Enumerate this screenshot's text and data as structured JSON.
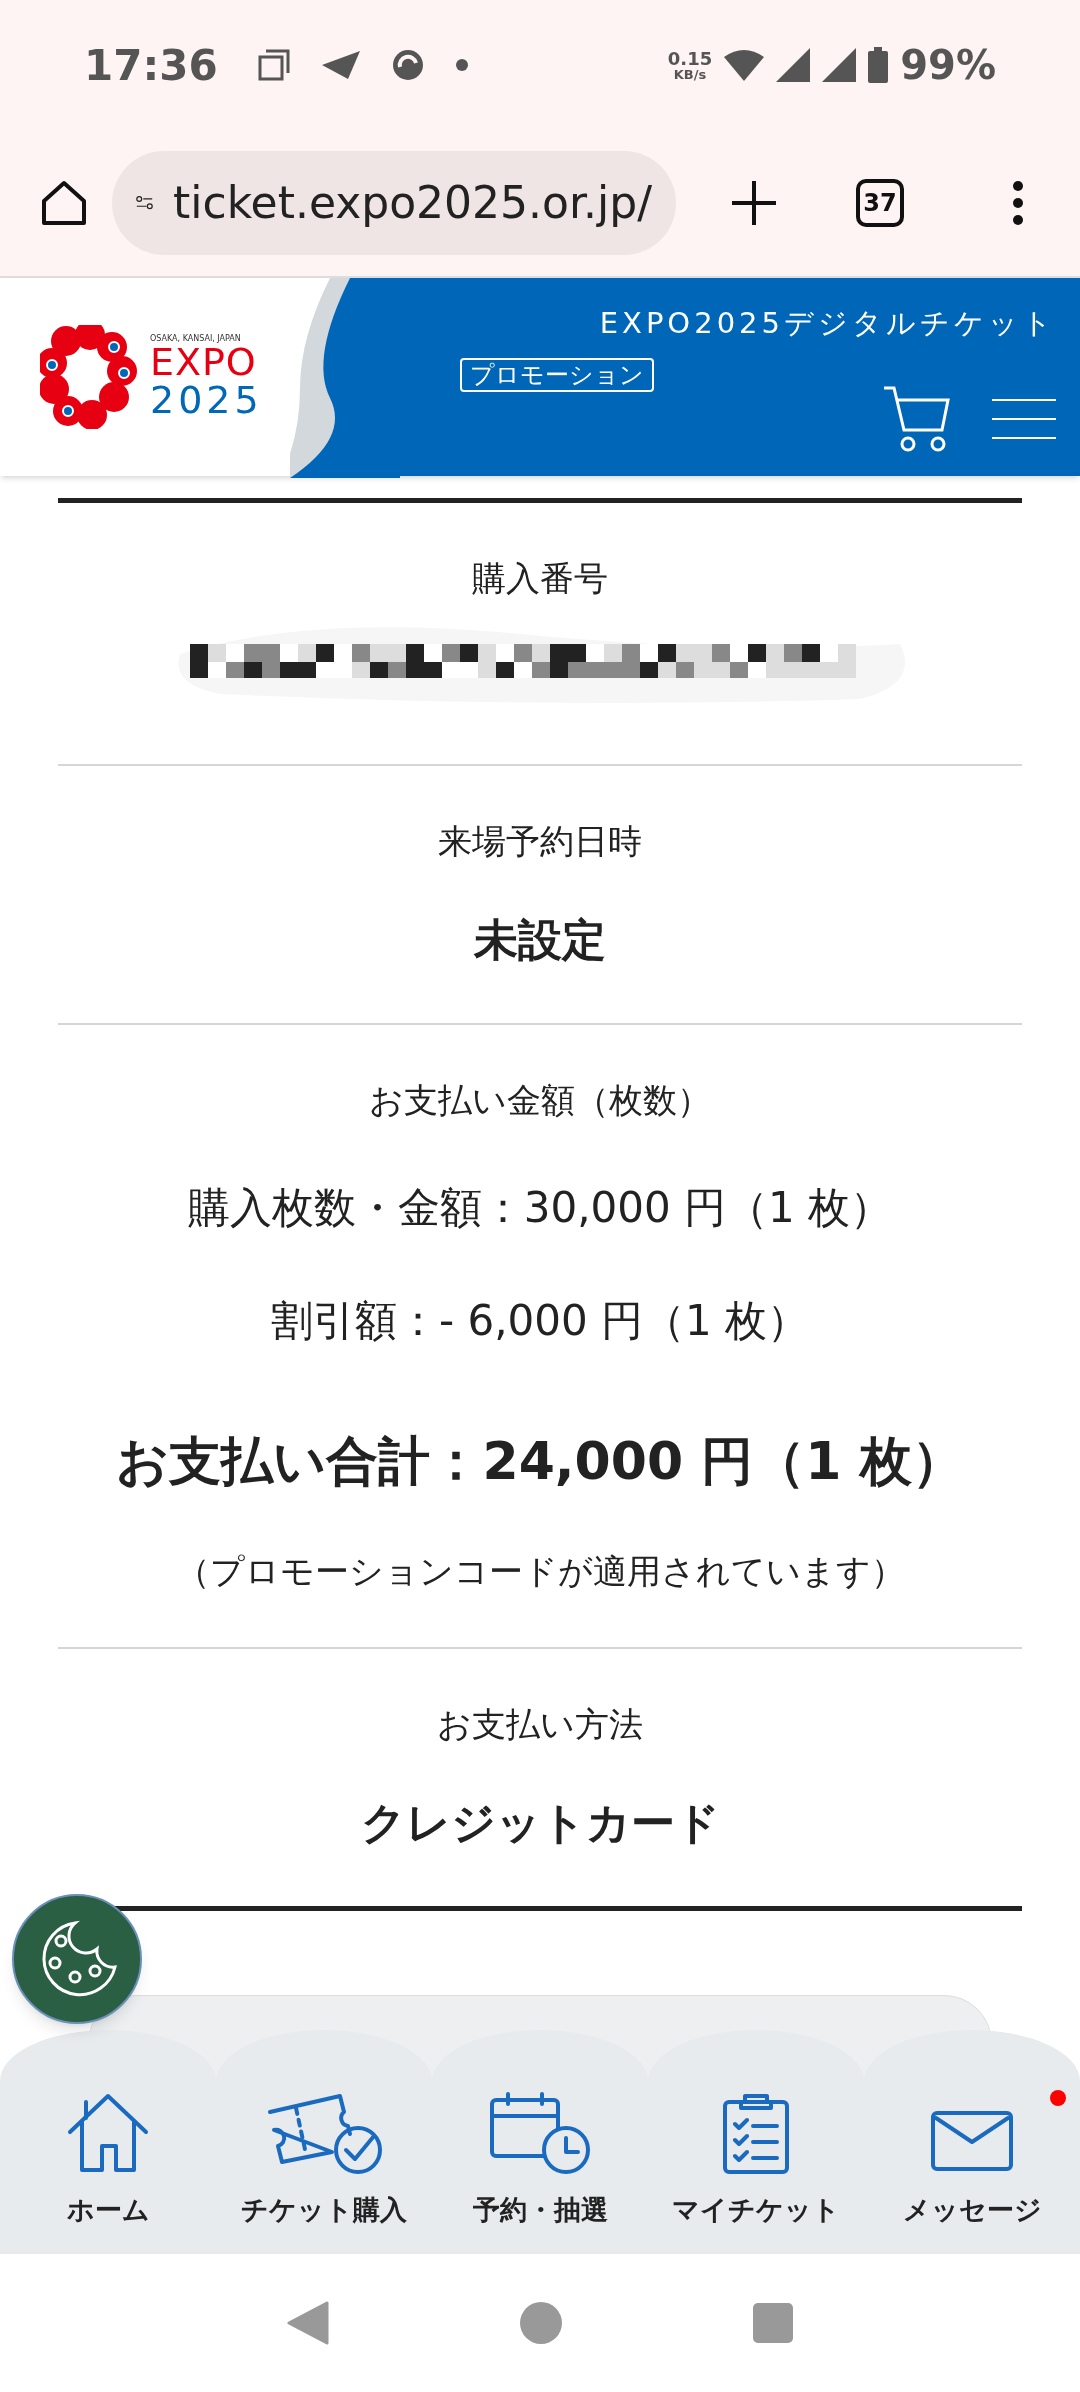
{
  "status_bar": {
    "time": "17:36",
    "net_speed": "0.15",
    "net_unit": "KB/s",
    "battery": "99%"
  },
  "browser": {
    "url": "ticket.expo2025.or.jp/",
    "tab_count": "37"
  },
  "header": {
    "logo_tagline": "OSAKA, KANSAI, JAPAN",
    "logo_word": "EXPO",
    "logo_year": "2025",
    "title": "EXPO2025デジタルチケット",
    "badge": "プロモーション"
  },
  "sections": [
    {
      "kind": "redacted",
      "label": "購入番号"
    },
    {
      "kind": "value",
      "label": "来場予約日時",
      "value": "未設定"
    },
    {
      "kind": "amounts",
      "label": "お支払い金額（枚数）",
      "lines": [
        "購入枚数・金額：30,000 円（1 枚）",
        "割引額：- 6,000 円（1 枚）"
      ],
      "total": "お支払い合計：24,000 円（1 枚）",
      "note": "（プロモーションコードが適用されています）"
    },
    {
      "kind": "value",
      "label": "お支払い方法",
      "value": "クレジットカード"
    }
  ],
  "bottom_nav": [
    {
      "kind": "home",
      "label": "ホーム",
      "unread": false
    },
    {
      "kind": "ticket",
      "label": "チケット購入",
      "unread": false
    },
    {
      "kind": "calendar",
      "label": "予約・抽選",
      "unread": false
    },
    {
      "kind": "clipboard",
      "label": "マイチケット",
      "unread": false
    },
    {
      "kind": "mail",
      "label": "メッセージ",
      "unread": true
    }
  ]
}
